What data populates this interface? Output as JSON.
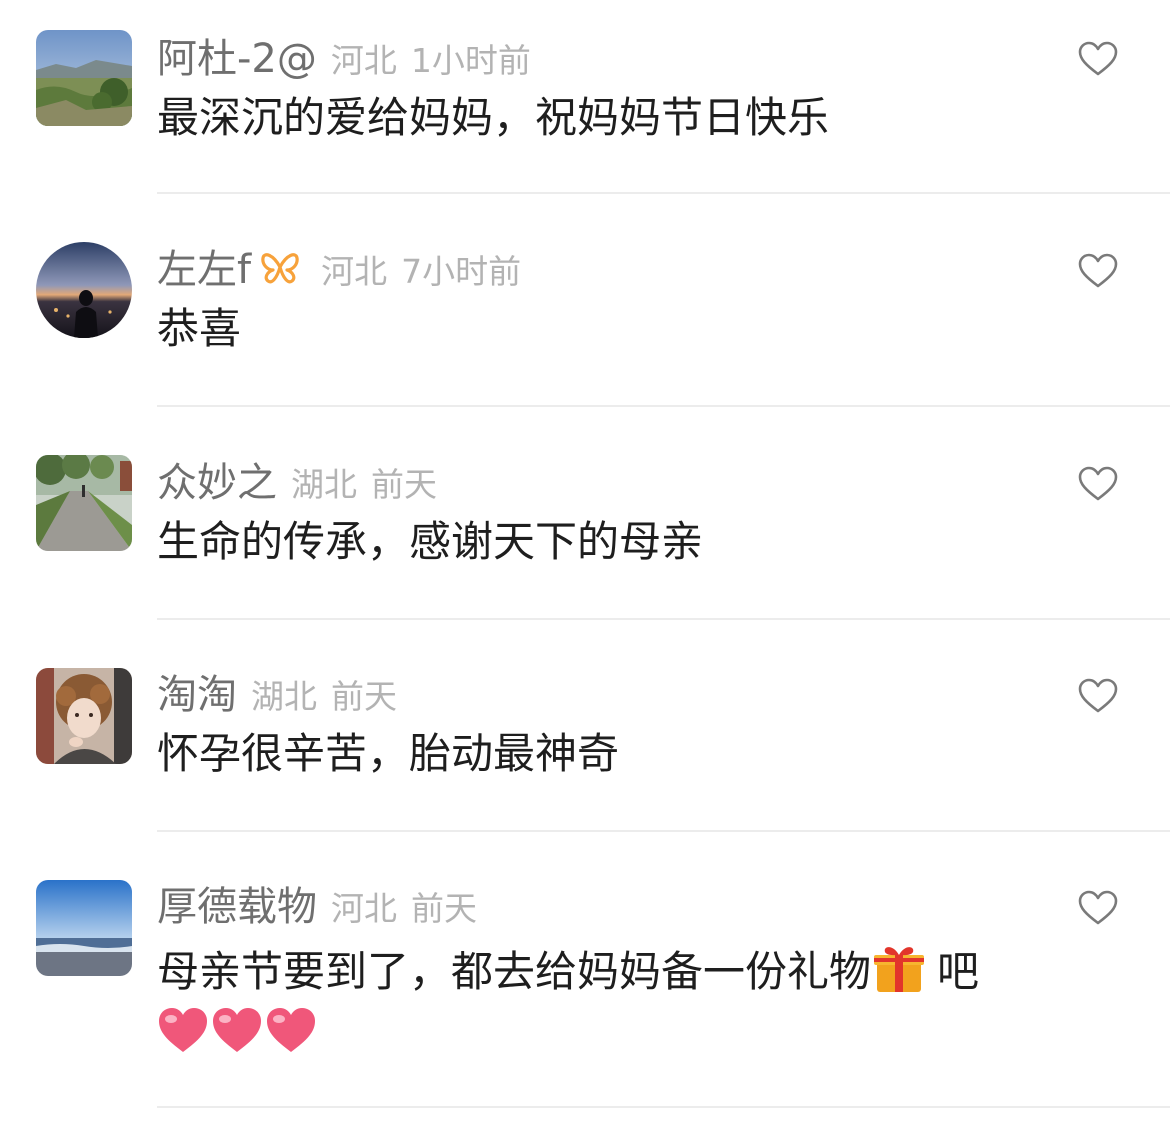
{
  "comments": [
    {
      "username": "阿杜-2@",
      "location": "河北",
      "time": "1小时前",
      "text": "最深沉的爱给妈妈，祝妈妈节日快乐",
      "avatar": "landscape-photo"
    },
    {
      "username": "左左f",
      "location": "河北",
      "time": "7小时前",
      "text": "恭喜",
      "avatar": "dusk-silhouette-photo",
      "badge_color": "#f7a23b"
    },
    {
      "username": "众妙之",
      "location": "湖北",
      "time": "前天",
      "text": "生命的传承，感谢天下的母亲",
      "avatar": "tree-path-photo"
    },
    {
      "username": "淘淘",
      "location": "湖北",
      "time": "前天",
      "text": "怀孕很辛苦，胎动最神奇",
      "avatar": "person-portrait-photo"
    },
    {
      "username": "厚德载物",
      "location": "河北",
      "time": "前天",
      "text": "母亲节要到了，都去给妈妈备一份礼物",
      "text_tail": "吧",
      "avatar": "sea-horizon-photo",
      "emojis": [
        "gift-emoji",
        "heart-emoji",
        "heart-emoji",
        "heart-emoji"
      ]
    }
  ],
  "colors": {
    "username": "#6f6f6f",
    "meta": "#b3b3b3",
    "content": "#1e1e1e",
    "like_icon": "#7a7a7a",
    "divider": "#ececec",
    "heart_emoji": "#f0577a"
  }
}
